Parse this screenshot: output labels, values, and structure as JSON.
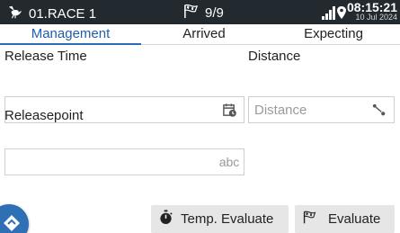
{
  "status_bar": {
    "race_name": "01.RACE 1",
    "count": "9/9",
    "time": "08:15:21",
    "date": "10 Jul 2024",
    "icons": {
      "race": "pigeon-icon",
      "count": "checkered-flag-icon",
      "signal": "signal-strength-icon",
      "location": "location-pin-icon"
    }
  },
  "tabs": [
    {
      "label": "Management",
      "active": true
    },
    {
      "label": "Arrived",
      "active": false
    },
    {
      "label": "Expecting",
      "active": false
    }
  ],
  "form": {
    "release_time": {
      "label": "Release Time",
      "value": "",
      "icon": "calendar-clock-icon"
    },
    "distance": {
      "label": "Distance",
      "placeholder": "Distance",
      "value": "",
      "icon": "map-route-icon"
    },
    "releasepoint": {
      "label": "Releasepoint",
      "value": "",
      "adornment": "abc"
    }
  },
  "actions": {
    "temp_evaluate": {
      "label": "Temp. Evaluate",
      "icon": "stopwatch-icon"
    },
    "evaluate": {
      "label": "Evaluate",
      "icon": "checkered-flag-icon"
    },
    "fab_icon": "navigation-diamond-icon"
  },
  "colors": {
    "status_bar_bg": "#22292f",
    "accent": "#2b6cb8",
    "button_bg": "#e6e6e6"
  }
}
